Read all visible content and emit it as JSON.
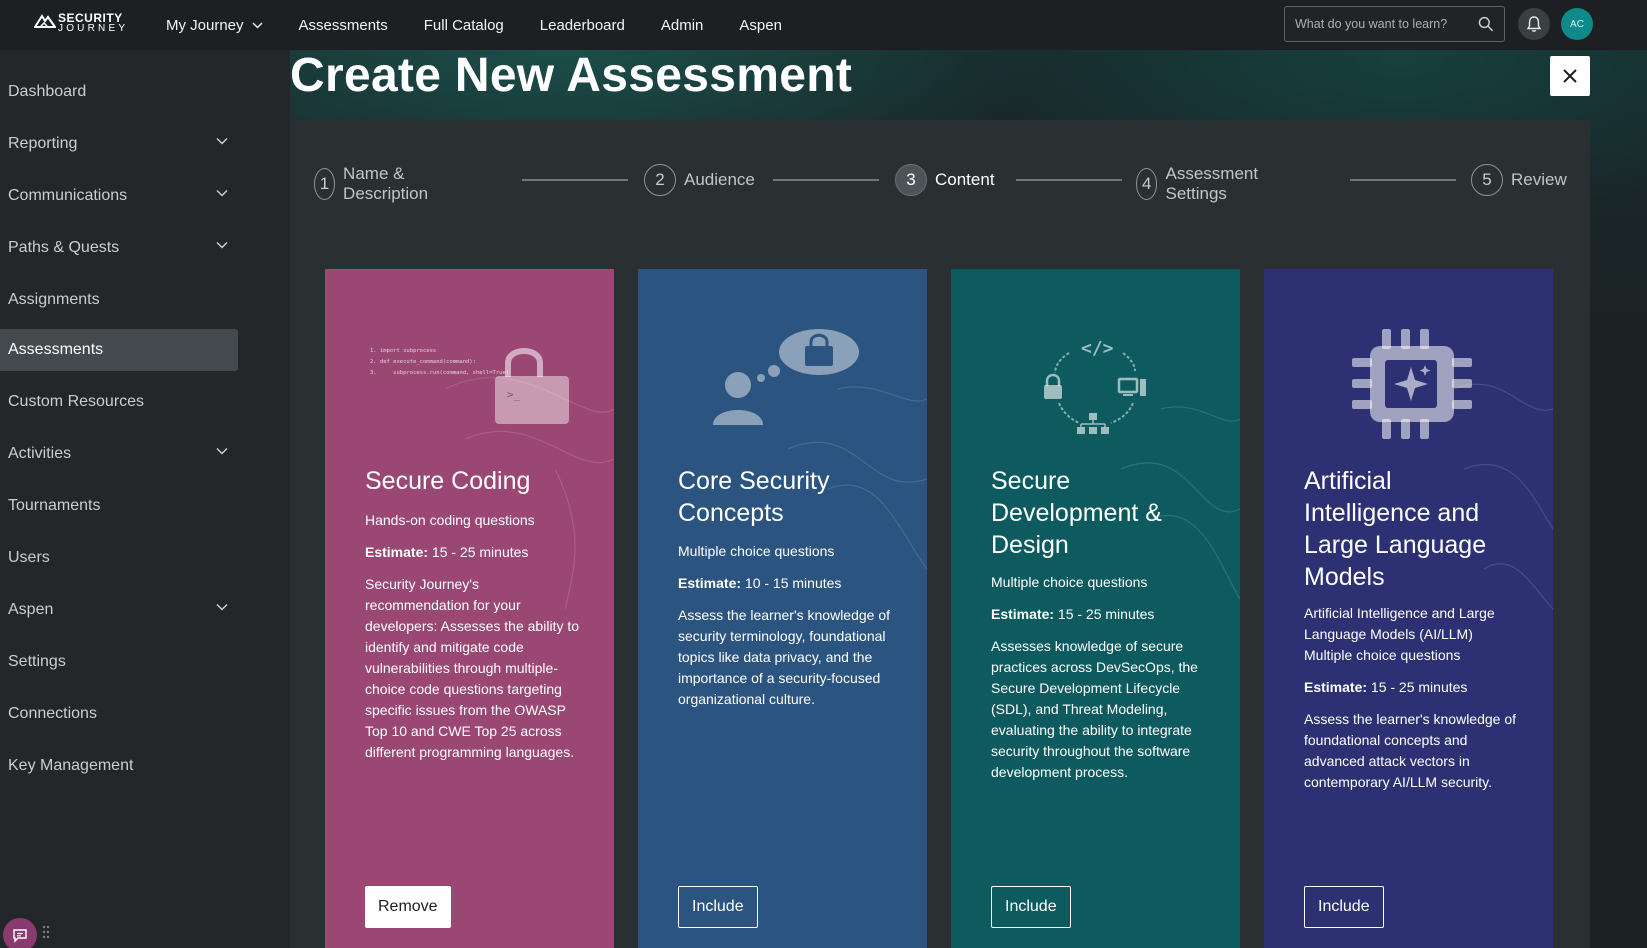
{
  "topbar": {
    "logo_line1": "SECURITY",
    "logo_line2": "JOURNEY",
    "nav": [
      {
        "label": "My Journey",
        "has_dropdown": true
      },
      {
        "label": "Assessments",
        "has_dropdown": false
      },
      {
        "label": "Full Catalog",
        "has_dropdown": false
      },
      {
        "label": "Leaderboard",
        "has_dropdown": false
      },
      {
        "label": "Admin",
        "has_dropdown": false
      },
      {
        "label": "Aspen",
        "has_dropdown": false
      }
    ],
    "search_placeholder": "What do you want to learn?",
    "avatar_initials": "AC"
  },
  "sidebar": {
    "items": [
      {
        "label": "Dashboard",
        "expandable": false,
        "active": false
      },
      {
        "label": "Reporting",
        "expandable": true,
        "active": false
      },
      {
        "label": "Communications",
        "expandable": true,
        "active": false
      },
      {
        "label": "Paths & Quests",
        "expandable": true,
        "active": false
      },
      {
        "label": "Assignments",
        "expandable": false,
        "active": false
      },
      {
        "label": "Assessments",
        "expandable": false,
        "active": true
      },
      {
        "label": "Custom Resources",
        "expandable": false,
        "active": false
      },
      {
        "label": "Activities",
        "expandable": true,
        "active": false
      },
      {
        "label": "Tournaments",
        "expandable": false,
        "active": false
      },
      {
        "label": "Users",
        "expandable": false,
        "active": false
      },
      {
        "label": "Aspen",
        "expandable": true,
        "active": false
      },
      {
        "label": "Settings",
        "expandable": false,
        "active": false
      },
      {
        "label": "Connections",
        "expandable": false,
        "active": false
      },
      {
        "label": "Key Management",
        "expandable": false,
        "active": false
      }
    ]
  },
  "page": {
    "title": "Create New Assessment"
  },
  "stepper": {
    "current_step": 3,
    "steps": [
      {
        "num": "1",
        "label": "Name & Description"
      },
      {
        "num": "2",
        "label": "Audience"
      },
      {
        "num": "3",
        "label": "Content"
      },
      {
        "num": "4",
        "label": "Assessment Settings"
      },
      {
        "num": "5",
        "label": "Review"
      }
    ]
  },
  "cards": [
    {
      "title": "Secure Coding",
      "type_line": "Hands-on coding questions",
      "estimate_label": "Estimate:",
      "estimate_value": " 15 - 25 minutes",
      "description": "Security Journey's recommendation for your developers: Assesses the ability to identify and mitigate code vulnerabilities through multiple-choice code questions targeting specific issues from the OWASP Top 10 and CWE Top 25 across different programming languages.",
      "button": "Remove",
      "color": "#9a4873",
      "code_lines": [
        "1. import subprocess",
        "2. def execute_command(command):",
        "3.     subprocess.run(command, shell=True)"
      ],
      "icon": "padlock-terminal-icon"
    },
    {
      "title": "Core Security Concepts",
      "type_line": "Multiple choice questions",
      "estimate_label": "Estimate:",
      "estimate_value": " 10 - 15 minutes",
      "description": "Assess the learner's knowledge of security terminology, foundational topics like data privacy, and the importance of a security-focused organizational culture.",
      "button": "Include",
      "color": "#2b5580",
      "icon": "person-thought-lock-icon"
    },
    {
      "title": "Secure Development & Design",
      "type_line": "Multiple choice questions",
      "estimate_label": "Estimate:",
      "estimate_value": " 15 - 25 minutes",
      "description": "Assesses knowledge of secure practices across DevSecOps, the Secure Development Lifecycle (SDL), and Threat Modeling, evaluating the ability to integrate security throughout the software development process.",
      "button": "Include",
      "color": "#0d5b5f",
      "icon": "sdlc-cycle-icon"
    },
    {
      "title": "Artificial Intelligence and Large Language Models",
      "type_line": "Artificial Intelligence and Large Language Models (AI/LLM) Multiple choice questions",
      "estimate_label": "Estimate:",
      "estimate_value": " 15 - 25 minutes",
      "description": "Assess the learner's knowledge of foundational concepts and advanced attack vectors in contemporary AI/LLM security.",
      "button": "Include",
      "color": "#2d3173",
      "icon": "ai-chip-icon"
    }
  ]
}
